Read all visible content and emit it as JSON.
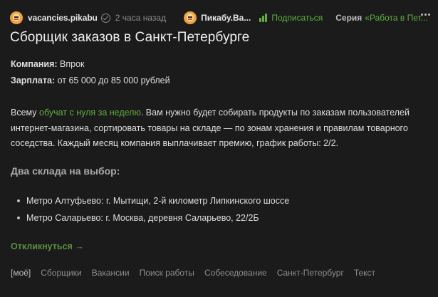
{
  "header": {
    "author": "vacancies.pikabu",
    "time": "2 часа назад",
    "community": "Пикабу.Ва...",
    "subscribe_label": "Подписаться",
    "series_label": "Серия",
    "series_link": "«Работа в Пет..."
  },
  "post": {
    "title": "Сборщик заказов в Санкт-Петербурге",
    "company_label": "Компания:",
    "company_value": " Впрок",
    "salary_label": "Зарплата:",
    "salary_value": " от 65 000 до 85 000 рублей",
    "paragraph": {
      "prefix": "Всему ",
      "link": "обучат с нуля за неделю",
      "suffix": ". Вам нужно будет собирать продукты по заказам пользователей интернет-магазина, сортировать товары на складе — по зонам хранения и правилам товарного соседства. Каждый месяц компания выплачивает премию, график работы: 2/2."
    },
    "subheading": "Два склада на выбор:",
    "list": [
      "Метро Алтуфьево: г. Мытищи, 2-й километр Липкинского шоссе",
      "Метро Саларьево: г. Москва, деревня Саларьево, 22/2Б"
    ],
    "respond_label": "Откликнуться →"
  },
  "tags": [
    "[моё]",
    "Сборщики",
    "Вакансии",
    "Поиск работы",
    "Собеседование",
    "Санкт-Петербург",
    "Текст"
  ],
  "colors": {
    "background": "#1b1b1b",
    "accent_green": "#5fae3f",
    "muted": "#8d8d8d"
  },
  "icons": [
    "avatar",
    "verified-icon",
    "subscribe-icon",
    "more-icon"
  ]
}
